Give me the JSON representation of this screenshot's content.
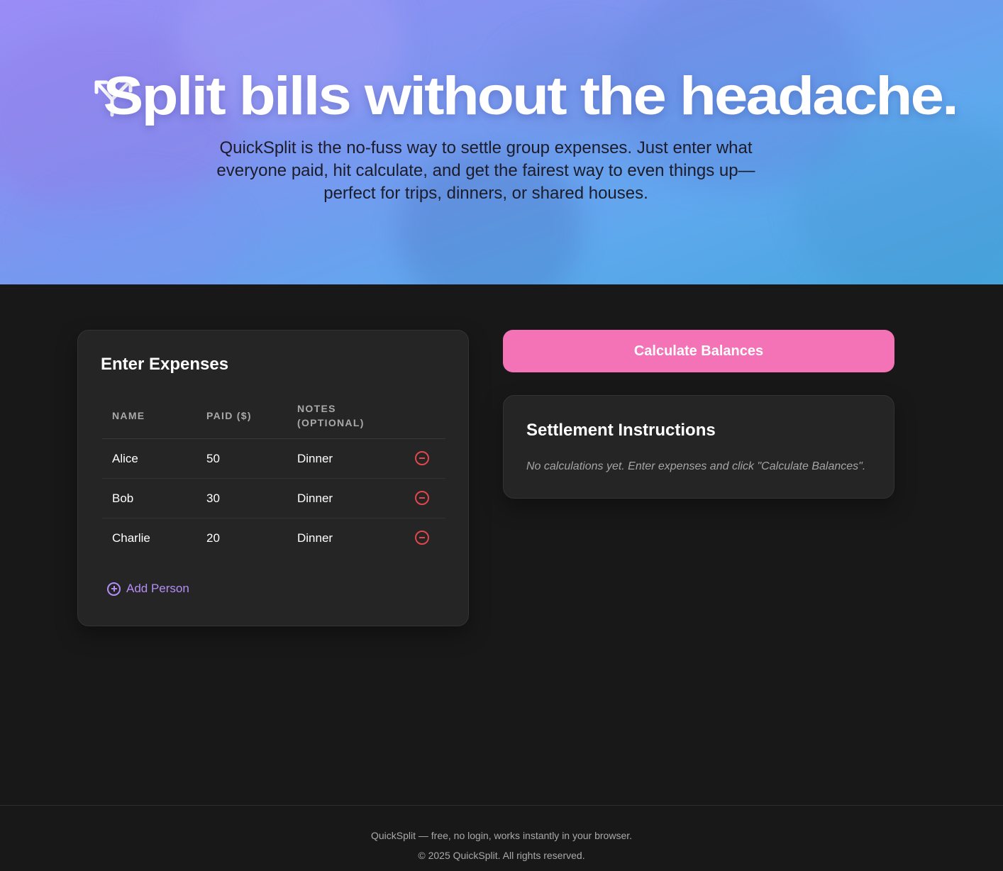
{
  "hero": {
    "icon": "split-arrows-icon",
    "title": "Split bills without the headache.",
    "subtitle": "QuickSplit is the no-fuss way to settle group expenses. Just enter what everyone paid, hit calculate, and get the fairest way to even things up—perfect for trips, dinners, or shared houses."
  },
  "expenses": {
    "heading": "Enter Expenses",
    "columns": [
      "NAME",
      "PAID ($)",
      "NOTES (OPTIONAL)"
    ],
    "rows": [
      {
        "name": "Alice",
        "paid": "50",
        "notes": "Dinner"
      },
      {
        "name": "Bob",
        "paid": "30",
        "notes": "Dinner"
      },
      {
        "name": "Charlie",
        "paid": "20",
        "notes": "Dinner"
      }
    ],
    "remove_icon": "minus-circle-icon",
    "add_label": "Add Person",
    "add_icon": "plus-circle-icon"
  },
  "actions": {
    "calculate_label": "Calculate Balances"
  },
  "settlement": {
    "heading": "Settlement Instructions",
    "empty_text": "No calculations yet. Enter expenses and click \"Calculate Balances\"."
  },
  "footer": {
    "tagline": "QuickSplit — free, no login, works instantly in your browser.",
    "copyright": "© 2025 QuickSplit. All rights reserved."
  },
  "colors": {
    "accent_pink": "#f472b6",
    "accent_purple": "#b48ef5",
    "danger_red": "#e2474b",
    "background": "#181818",
    "card": "#252525"
  }
}
